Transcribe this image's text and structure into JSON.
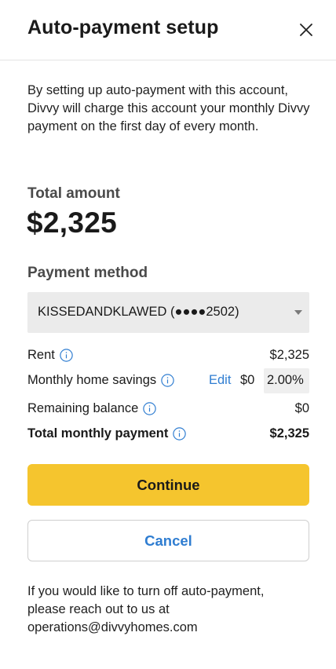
{
  "header": {
    "title": "Auto-payment setup"
  },
  "intro": {
    "text": "By setting up auto-payment with this account, Divvy will charge this account your monthly Divvy payment on the first day of every month."
  },
  "total": {
    "label": "Total amount",
    "value": "$2,325"
  },
  "payment_method": {
    "label": "Payment method",
    "selected": "KISSEDANDKLAWED (●●●●2502)"
  },
  "breakdown": {
    "rent": {
      "label": "Rent",
      "value": "$2,325"
    },
    "savings": {
      "label": "Monthly home savings",
      "edit": "Edit",
      "value": "$0",
      "percent": "2.00%"
    },
    "remaining": {
      "label": "Remaining balance",
      "value": "$0"
    },
    "total": {
      "label": "Total monthly payment",
      "value": "$2,325"
    }
  },
  "buttons": {
    "continue": "Continue",
    "cancel": "Cancel"
  },
  "footer": {
    "line1": "If you would like to turn off auto-payment,",
    "line2": "please reach out to us at",
    "email": "operations@divvyhomes.com"
  },
  "colors": {
    "accent": "#f5c52e",
    "link": "#2f7dd1"
  },
  "icons": {
    "close": "close-icon",
    "info": "info-icon",
    "dropdown": "chevron-down-icon"
  }
}
